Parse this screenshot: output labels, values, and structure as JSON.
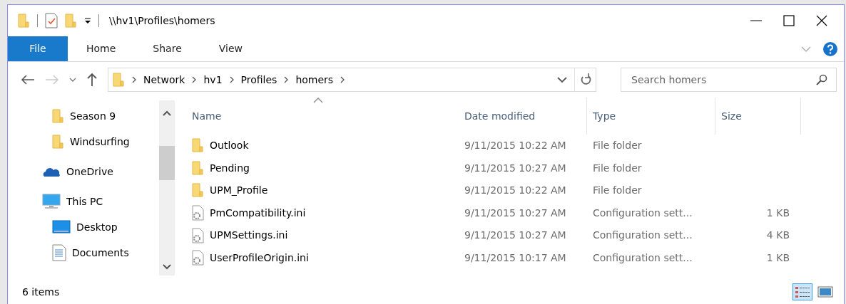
{
  "window": {
    "title": "\\\\hv1\\Profiles\\homers"
  },
  "ribbon_tabs": [
    {
      "label": "File",
      "selected": true
    },
    {
      "label": "Home",
      "selected": false
    },
    {
      "label": "Share",
      "selected": false
    },
    {
      "label": "View",
      "selected": false
    }
  ],
  "address_bar": {
    "crumbs": [
      "Network",
      "hv1",
      "Profiles",
      "homers"
    ]
  },
  "search": {
    "placeholder": "Search homers"
  },
  "nav_pane": {
    "items": [
      {
        "label": "Season 9",
        "kind": "folder"
      },
      {
        "label": "Windsurfing",
        "kind": "folder"
      },
      {
        "label": "OneDrive",
        "kind": "cloud"
      },
      {
        "label": "This PC",
        "kind": "pc",
        "children": [
          {
            "label": "Desktop",
            "kind": "desktop"
          },
          {
            "label": "Documents",
            "kind": "documents"
          }
        ]
      }
    ]
  },
  "file_list": {
    "columns": [
      {
        "label": "Name",
        "sorted": true
      },
      {
        "label": "Date modified",
        "sorted": false
      },
      {
        "label": "Type",
        "sorted": false
      },
      {
        "label": "Size",
        "sorted": false
      }
    ],
    "rows": [
      {
        "kind": "folder",
        "name": "Outlook",
        "date": "9/11/2015 10:22 AM",
        "type": "File folder"
      },
      {
        "kind": "folder",
        "name": "Pending",
        "date": "9/11/2015 10:27 AM",
        "type": "File folder"
      },
      {
        "kind": "folder",
        "name": "UPM_Profile",
        "date": "9/11/2015 10:22 AM",
        "type": "File folder"
      },
      {
        "kind": "settings",
        "name": "PmCompatibility.ini",
        "date": "9/11/2015 10:27 AM",
        "type": "Configuration sett...",
        "size": "1 KB"
      },
      {
        "kind": "settings",
        "name": "UPMSettings.ini",
        "date": "9/11/2015 10:27 AM",
        "type": "Configuration sett...",
        "size": "4 KB"
      },
      {
        "kind": "settings",
        "name": "UserProfileOrigin.ini",
        "date": "9/11/2015 10:17 AM",
        "type": "Configuration sett...",
        "size": "1 KB"
      }
    ]
  },
  "status_bar": {
    "count": "6 items",
    "views": [
      {
        "kind": "details",
        "selected": true
      },
      {
        "kind": "tiles",
        "selected": false
      }
    ]
  }
}
